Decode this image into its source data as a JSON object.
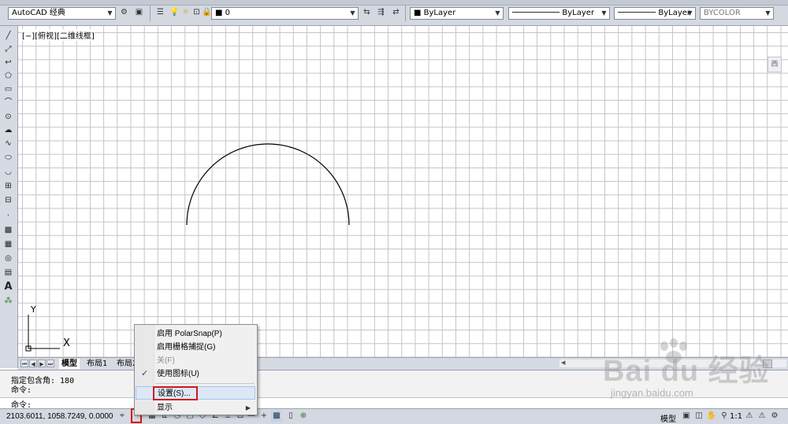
{
  "toolbar": {
    "workspace": "AutoCAD 经典",
    "layer": "0",
    "color": "ByLayer",
    "linetype": "ByLayer",
    "lineweight": "ByLayer",
    "plotstyle": "BYCOLOR"
  },
  "viewport_label": "[−][俯视][二维线框]",
  "viewcube_label": "西",
  "ucs": {
    "y": "Y",
    "x": "X"
  },
  "tabs": {
    "model": "模型",
    "layout1": "布局1",
    "layout2": "布局2"
  },
  "command": {
    "history1": "指定包含角: 180",
    "history2": "命令:",
    "prompt": "命令:"
  },
  "status": {
    "coords": "2103.6011, 1058.7249, 0.0000",
    "model": "模型",
    "annotation_scale": "1:1"
  },
  "context_menu": {
    "items": [
      {
        "label": "启用 PolarSnap(P)"
      },
      {
        "label": "启用栅格捕捉(G)"
      },
      {
        "label": "关(F)"
      },
      {
        "label": "使用图标(U)"
      },
      {
        "label": "设置(S)..."
      },
      {
        "label": "显示"
      }
    ]
  },
  "watermark": {
    "brand": "Bai du 经验",
    "url": "jingyan.baidu.com"
  },
  "colors": {
    "highlight_box": "#d01818",
    "menu_hover": "#dce8f6"
  }
}
